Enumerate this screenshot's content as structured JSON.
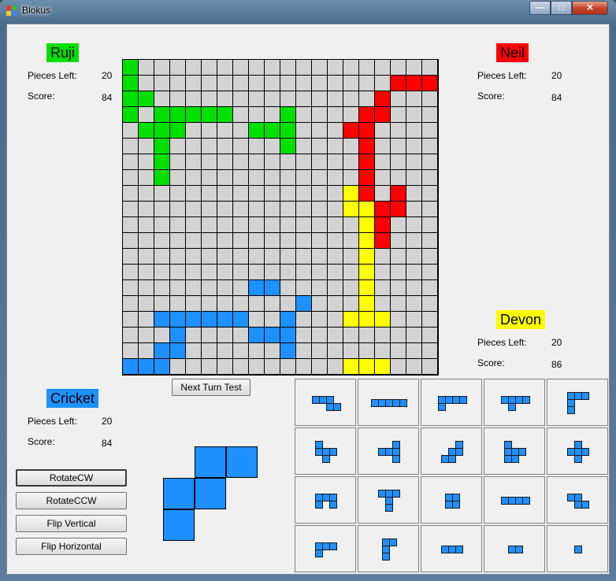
{
  "window": {
    "title": "Blokus"
  },
  "colors": {
    "green": "#00e000",
    "red": "#ff0000",
    "yellow": "#ffff00",
    "blue": "#1e90ff",
    "empty": "#d3d3d3"
  },
  "players": {
    "ruji": {
      "name": "Ruji",
      "pieces_label": "Pieces Left:",
      "pieces": "20",
      "score_label": "Score:",
      "score": "84",
      "color": "#00e000"
    },
    "neil": {
      "name": "Neil",
      "pieces_label": "Pieces Left:",
      "pieces": "20",
      "score_label": "Score:",
      "score": "84",
      "color": "#ff0000"
    },
    "devon": {
      "name": "Devon",
      "pieces_label": "Pieces Left:",
      "pieces": "20",
      "score_label": "Score:",
      "score": "86",
      "color": "#ffff00"
    },
    "cricket": {
      "name": "Cricket",
      "pieces_label": "Pieces Left:",
      "pieces": "20",
      "score_label": "Score:",
      "score": "84",
      "color": "#1e90ff"
    }
  },
  "board": {
    "size": 20,
    "rows": [
      "g...................",
      "g................rrr",
      "gg..............r...",
      "g.ggggg...g....rr...",
      ".ggg....ggg...rr....",
      "..g.......g....r....",
      "..g............r....",
      "..g............r....",
      "..............yr.r..",
      "..............yyrr..",
      "...............yr...",
      "...............yr...",
      "...............y....",
      "...............y....",
      "........bb.....y....",
      "...........b...y....",
      "..bbbbbb..b...yyy...",
      "...b....bbb.........",
      "..bb......b.........",
      "bbb...........yyy..."
    ]
  },
  "buttons": {
    "next_turn": "Next Turn Test",
    "rotate_cw": "RotateCW",
    "rotate_ccw": "RotateCCW",
    "flip_vertical": "Flip Vertical",
    "flip_horizontal": "Flip Horizontal"
  },
  "selected_piece": [
    [
      1,
      0
    ],
    [
      2,
      0
    ],
    [
      0,
      1
    ],
    [
      1,
      1
    ],
    [
      0,
      2
    ]
  ],
  "palette": [
    [
      [
        0,
        0
      ],
      [
        1,
        0
      ],
      [
        2,
        0
      ],
      [
        2,
        1
      ],
      [
        3,
        1
      ]
    ],
    [
      [
        0,
        0
      ],
      [
        1,
        0
      ],
      [
        2,
        0
      ],
      [
        3,
        0
      ],
      [
        4,
        0
      ]
    ],
    [
      [
        0,
        0
      ],
      [
        1,
        0
      ],
      [
        2,
        0
      ],
      [
        3,
        0
      ],
      [
        0,
        1
      ]
    ],
    [
      [
        0,
        0
      ],
      [
        1,
        0
      ],
      [
        2,
        0
      ],
      [
        3,
        0
      ],
      [
        1,
        1
      ]
    ],
    [
      [
        0,
        0
      ],
      [
        1,
        0
      ],
      [
        2,
        0
      ],
      [
        0,
        1
      ],
      [
        0,
        2
      ]
    ],
    [
      [
        0,
        0
      ],
      [
        0,
        1
      ],
      [
        1,
        1
      ],
      [
        2,
        1
      ],
      [
        1,
        2
      ]
    ],
    [
      [
        2,
        0
      ],
      [
        0,
        1
      ],
      [
        1,
        1
      ],
      [
        2,
        1
      ],
      [
        2,
        2
      ]
    ],
    [
      [
        2,
        0
      ],
      [
        2,
        1
      ],
      [
        1,
        1
      ],
      [
        1,
        2
      ],
      [
        0,
        2
      ]
    ],
    [
      [
        0,
        0
      ],
      [
        0,
        1
      ],
      [
        1,
        1
      ],
      [
        2,
        1
      ],
      [
        0,
        2
      ],
      [
        1,
        2
      ]
    ],
    [
      [
        1,
        0
      ],
      [
        0,
        1
      ],
      [
        1,
        1
      ],
      [
        2,
        1
      ],
      [
        1,
        2
      ]
    ],
    [
      [
        0,
        0
      ],
      [
        1,
        0
      ],
      [
        2,
        0
      ],
      [
        0,
        1
      ],
      [
        2,
        1
      ]
    ],
    [
      [
        0,
        0
      ],
      [
        1,
        0
      ],
      [
        2,
        0
      ],
      [
        1,
        1
      ],
      [
        1,
        2
      ]
    ],
    [
      [
        0,
        0
      ],
      [
        1,
        0
      ],
      [
        0,
        1
      ],
      [
        1,
        1
      ]
    ],
    [
      [
        0,
        0
      ],
      [
        1,
        0
      ],
      [
        2,
        0
      ],
      [
        3,
        0
      ]
    ],
    [
      [
        0,
        0
      ],
      [
        1,
        0
      ],
      [
        1,
        1
      ],
      [
        2,
        1
      ]
    ],
    [
      [
        0,
        0
      ],
      [
        1,
        0
      ],
      [
        2,
        0
      ],
      [
        0,
        1
      ]
    ],
    [
      [
        0,
        0
      ],
      [
        1,
        0
      ],
      [
        0,
        1
      ],
      [
        0,
        2
      ]
    ],
    [
      [
        0,
        0
      ],
      [
        1,
        0
      ],
      [
        2,
        0
      ]
    ],
    [
      [
        0,
        0
      ],
      [
        1,
        0
      ]
    ],
    [
      [
        0,
        0
      ]
    ]
  ]
}
